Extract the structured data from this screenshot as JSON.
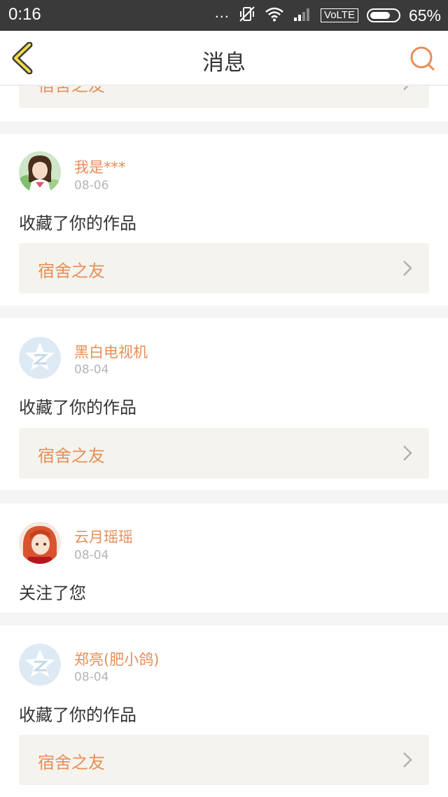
{
  "status_bar": {
    "time": "0:16",
    "dots": "...",
    "network_label": "VoLTE",
    "battery_percent": "65%"
  },
  "header": {
    "title": "消息",
    "back_icon": "back-chevron-icon",
    "search_icon": "search-icon"
  },
  "partial_item": {
    "work_title": "宿舍之友"
  },
  "messages": [
    {
      "user": "我是***",
      "date": "08-06",
      "action": "收藏了你的作品",
      "work_title": "宿舍之友",
      "avatar": "anime-girl-avatar"
    },
    {
      "user": "黑白电视机",
      "date": "08-04",
      "action": "收藏了你的作品",
      "work_title": "宿舍之友",
      "avatar": "default-qzone-avatar"
    },
    {
      "user": "云月瑶瑶",
      "date": "08-04",
      "action": "关注了您",
      "avatar": "red-hair-anime-avatar"
    },
    {
      "user": "郑亮(肥小鸽)",
      "date": "08-04",
      "action": "收藏了你的作品",
      "work_title": "宿舍之友",
      "avatar": "default-qzone-avatar"
    }
  ],
  "colors": {
    "accent": "#e88e57",
    "status_bar_bg": "#3a3a3a",
    "work_link_bg": "#f4f3ee",
    "page_bg": "#f5f5f5"
  }
}
